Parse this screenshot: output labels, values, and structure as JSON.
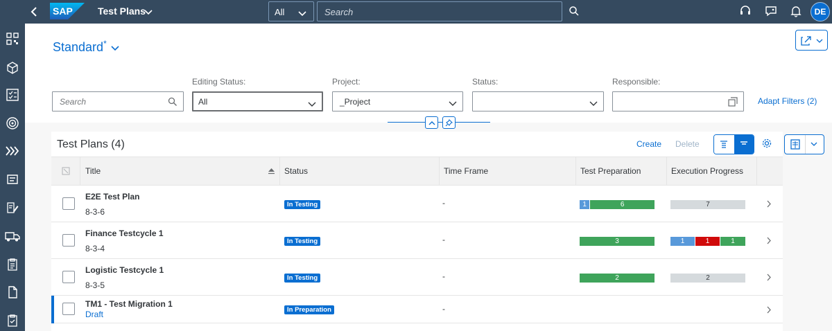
{
  "shell": {
    "brand": "SAP",
    "app_title": "Test Plans",
    "scope": "All",
    "search_placeholder": "Search",
    "user_initials": "DE"
  },
  "header": {
    "variant": "Standard",
    "variant_modified": "*",
    "filters": [
      {
        "label": "",
        "value": "",
        "placeholder": "Search"
      },
      {
        "label": "Editing Status:",
        "value": "All"
      },
      {
        "label": "Project:",
        "value": "_Project"
      },
      {
        "label": "Status:",
        "value": ""
      },
      {
        "label": "Responsible:",
        "value": ""
      }
    ],
    "adapt_filters": "Adapt Filters (2)"
  },
  "table": {
    "title": "Test Plans (4)",
    "create": "Create",
    "delete": "Delete",
    "columns": [
      "Title",
      "Status",
      "Time Frame",
      "Test Preparation",
      "Execution Progress"
    ],
    "rows": [
      {
        "title": "E2E Test Plan",
        "sub": "8-3-6",
        "status": "In Testing",
        "time_frame": "-",
        "prep": [
          {
            "value": 1,
            "label": "1",
            "color": "#5899da"
          },
          {
            "value": 6,
            "label": "6",
            "color": "#3fa45b"
          }
        ],
        "exec": [
          {
            "value": 7,
            "label": "7",
            "color": "#d5dadd"
          }
        ]
      },
      {
        "title": "Finance Testcycle 1",
        "sub": "8-3-4",
        "status": "In Testing",
        "time_frame": "-",
        "prep": [
          {
            "value": 3,
            "label": "3",
            "color": "#3fa45b"
          }
        ],
        "exec": [
          {
            "value": 1,
            "label": "1",
            "color": "#5899da"
          },
          {
            "value": 1,
            "label": "1",
            "color": "#d00a0a"
          },
          {
            "value": 1,
            "label": "1",
            "color": "#3fa45b"
          }
        ]
      },
      {
        "title": "Logistic Testcycle 1",
        "sub": "8-3-5",
        "status": "In Testing",
        "time_frame": "-",
        "prep": [
          {
            "value": 2,
            "label": "2",
            "color": "#3fa45b"
          }
        ],
        "exec": [
          {
            "value": 2,
            "label": "2",
            "color": "#d5dadd"
          }
        ]
      },
      {
        "title": "TM1 - Test Migration 1",
        "sub": "Draft",
        "status": "In Preparation",
        "time_frame": "-",
        "prep": [],
        "exec": []
      }
    ]
  }
}
